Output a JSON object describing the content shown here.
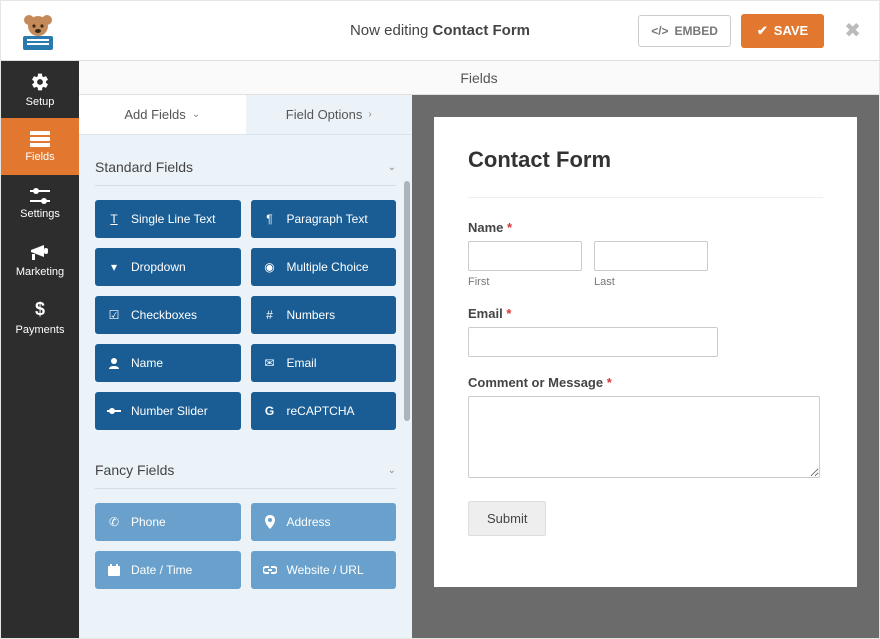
{
  "header": {
    "title_prefix": "Now editing ",
    "title_bold": "Contact Form",
    "embed_label": "EMBED",
    "save_label": "SAVE"
  },
  "nav": {
    "items": [
      {
        "id": "setup",
        "label": "Setup"
      },
      {
        "id": "fields",
        "label": "Fields",
        "active": true
      },
      {
        "id": "settings",
        "label": "Settings"
      },
      {
        "id": "marketing",
        "label": "Marketing"
      },
      {
        "id": "payments",
        "label": "Payments"
      }
    ]
  },
  "subheader": {
    "title": "Fields"
  },
  "panel": {
    "tabs": {
      "add": "Add Fields",
      "options": "Field Options"
    },
    "groups": {
      "standard": {
        "title": "Standard Fields",
        "items": [
          {
            "label": "Single Line Text"
          },
          {
            "label": "Paragraph Text"
          },
          {
            "label": "Dropdown"
          },
          {
            "label": "Multiple Choice"
          },
          {
            "label": "Checkboxes"
          },
          {
            "label": "Numbers"
          },
          {
            "label": "Name"
          },
          {
            "label": "Email"
          },
          {
            "label": "Number Slider"
          },
          {
            "label": "reCAPTCHA"
          }
        ]
      },
      "fancy": {
        "title": "Fancy Fields",
        "items": [
          {
            "label": "Phone"
          },
          {
            "label": "Address"
          },
          {
            "label": "Date / Time"
          },
          {
            "label": "Website / URL"
          }
        ]
      }
    }
  },
  "preview": {
    "form_title": "Contact Form",
    "name_label": "Name",
    "first_sublabel": "First",
    "last_sublabel": "Last",
    "email_label": "Email",
    "comment_label": "Comment or Message",
    "submit_label": "Submit",
    "required_marker": "*"
  }
}
